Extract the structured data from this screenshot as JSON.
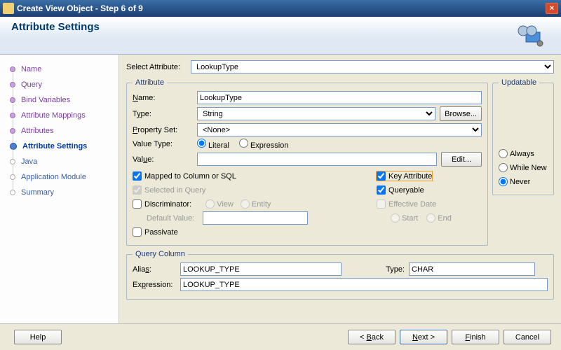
{
  "window": {
    "title": "Create View Object - Step 6 of 9"
  },
  "header": {
    "title": "Attribute Settings"
  },
  "steps": [
    {
      "label": "Name",
      "state": "visited"
    },
    {
      "label": "Query",
      "state": "visited"
    },
    {
      "label": "Bind Variables",
      "state": "visited"
    },
    {
      "label": "Attribute Mappings",
      "state": "visited"
    },
    {
      "label": "Attributes",
      "state": "visited"
    },
    {
      "label": "Attribute Settings",
      "state": "current"
    },
    {
      "label": "Java",
      "state": "future"
    },
    {
      "label": "Application Module",
      "state": "future"
    },
    {
      "label": "Summary",
      "state": "future"
    }
  ],
  "select_attr_label": "Select Attribute:",
  "select_attr_value": "LookupType",
  "attribute": {
    "legend": "Attribute",
    "name_label": "Name:",
    "name_value": "LookupType",
    "type_label": "Type:",
    "type_value": "String",
    "browse_btn": "Browse...",
    "propset_label": "Property Set:",
    "propset_value": "<None>",
    "valtype_label": "Value Type:",
    "literal": "Literal",
    "expression": "Expression",
    "value_label": "Value:",
    "value_value": "",
    "edit_btn": "Edit...",
    "mapped": "Mapped to Column or SQL",
    "selected_in_query": "Selected in Query",
    "discriminator": "Discriminator:",
    "view_opt": "View",
    "entity_opt": "Entity",
    "default_value": "Default Value:",
    "passivate": "Passivate",
    "key_attr": "Key Attribute",
    "queryable": "Queryable",
    "effective_date": "Effective Date",
    "start_opt": "Start",
    "end_opt": "End"
  },
  "updatable": {
    "legend": "Updatable",
    "always": "Always",
    "while_new": "While New",
    "never": "Never"
  },
  "query_col": {
    "legend": "Query Column",
    "alias_label": "Alias:",
    "alias_value": "LOOKUP_TYPE",
    "type_label": "Type:",
    "type_value": "CHAR",
    "expr_label": "Expression:",
    "expr_value": "LOOKUP_TYPE"
  },
  "footer": {
    "help": "Help",
    "back": "< Back",
    "next": "Next >",
    "finish": "Finish",
    "cancel": "Cancel"
  }
}
